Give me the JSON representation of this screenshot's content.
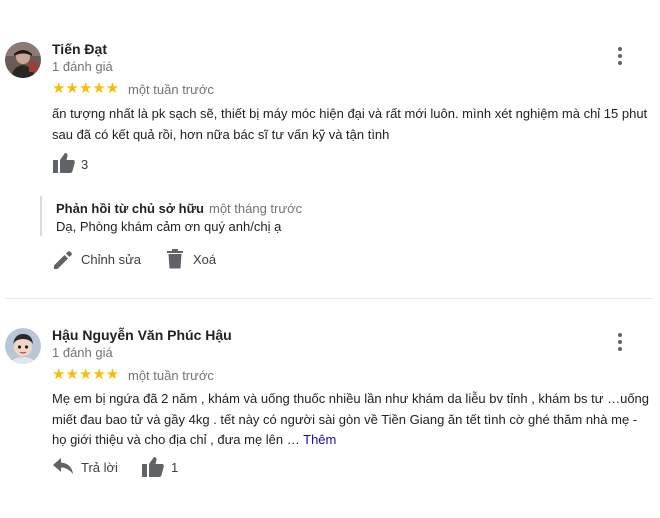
{
  "reviews": [
    {
      "name": "Tiến Đạt",
      "review_count": "1 đánh giá",
      "stars": "★★★★★",
      "rating": 5,
      "time": "một tuần trước",
      "text_line1": "ấn tượng nhất là pk sạch sẽ, thiết bị máy móc hiện đại và rất mới luôn. mình xét nghiệm mà chỉ 15 phut",
      "text_line2": "sau đã có kết quả rồi, hơn nữa bác sĩ tư vấn kỹ và tận tình",
      "likes": "3",
      "owner_reply": {
        "title": "Phản hồi từ chủ sở hữu",
        "time": "một tháng trước",
        "text": "Dạ, Phòng khám cảm ơn quý anh/chị ạ"
      },
      "edit_label": "Chỉnh sửa",
      "delete_label": "Xoá"
    },
    {
      "name": "Hậu Nguyễn Văn Phúc Hậu",
      "review_count": "1 đánh giá",
      "stars": "★★★★★",
      "rating": 5,
      "time": "một tuần trước",
      "text_line1": "Mẹ em bị ngứa đã 2 năm , khám và uống thuốc nhiều lần như khám da liễu bv tỉnh , khám bs tư …uống",
      "text_line2": "miết đau bao tử và gầy 4kg . tết này có người sài gòn về Tiền Giang ăn tết tình cờ ghé thăm nhà mẹ -",
      "text_line3": "họ giới thiệu và cho địa chỉ , đưa mẹ lên …",
      "more_label": "Thêm",
      "reply_label": "Trả lời",
      "likes": "1"
    }
  ],
  "icons": {
    "more": "more-vert-icon",
    "like": "thumb-up-icon",
    "edit": "pencil-icon",
    "delete": "trash-icon",
    "reply": "reply-arrow-icon"
  },
  "colors": {
    "star": "#fbbc04",
    "link": "#1a0dab",
    "muted": "#70757a",
    "icon": "#5f6368"
  }
}
